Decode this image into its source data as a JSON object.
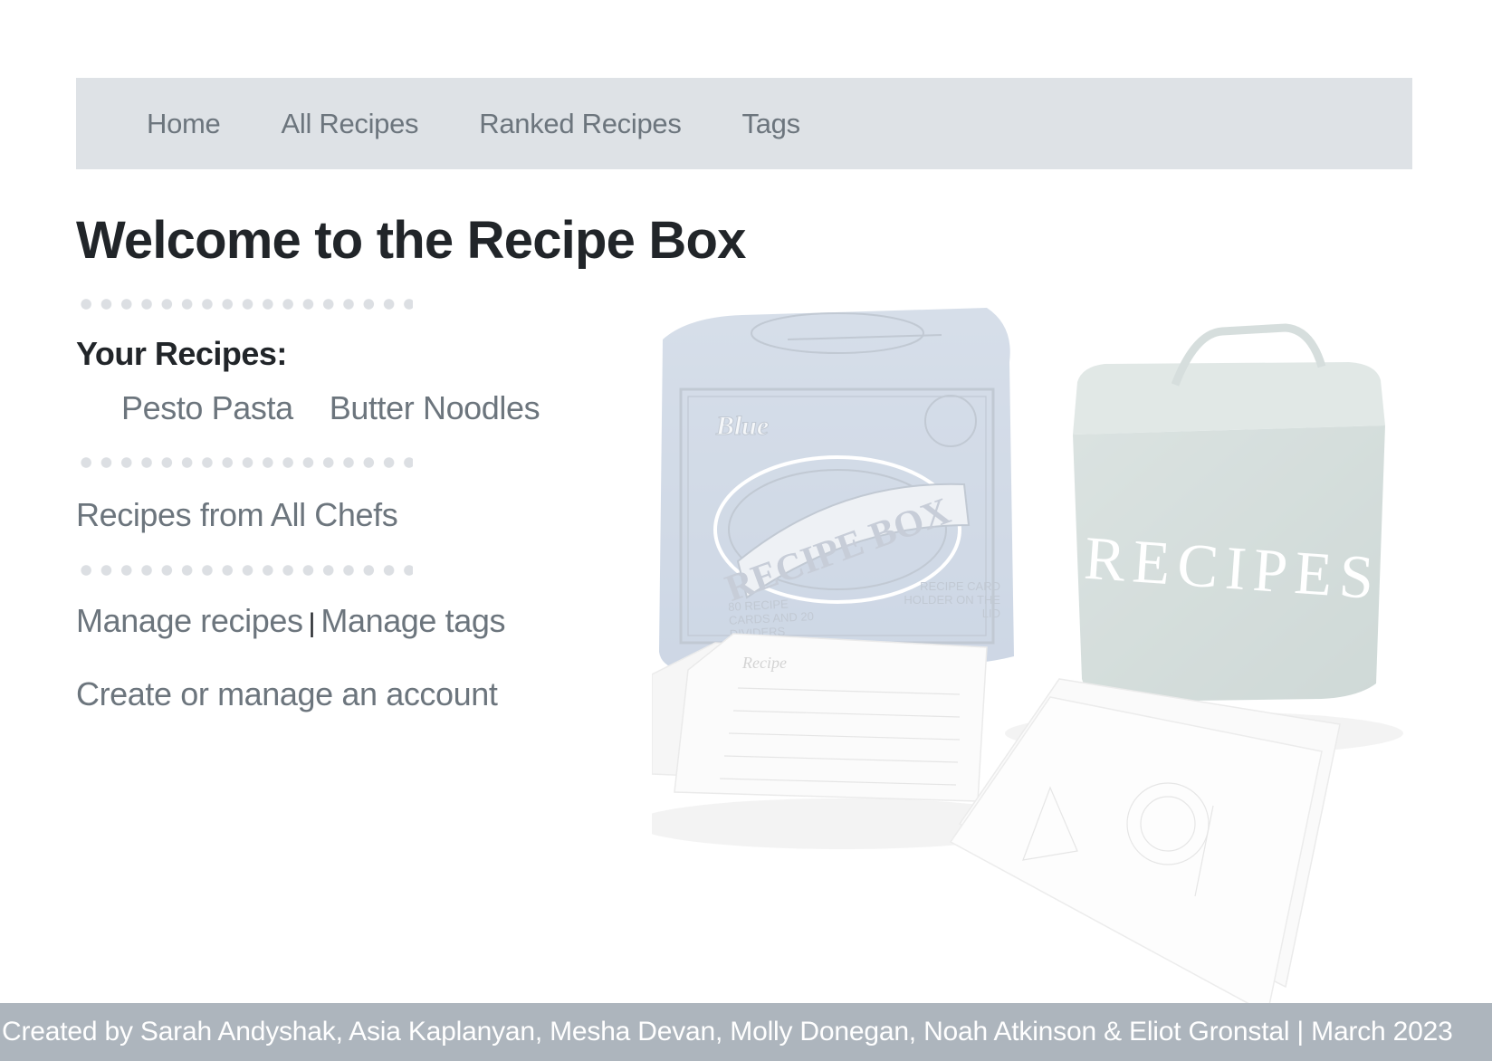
{
  "nav": {
    "items": [
      {
        "label": "Home"
      },
      {
        "label": "All Recipes"
      },
      {
        "label": "Ranked Recipes"
      },
      {
        "label": "Tags"
      }
    ]
  },
  "main": {
    "title": "Welcome to the Recipe Box",
    "your_recipes_heading": "Your Recipes:",
    "your_recipes": [
      {
        "label": "Pesto Pasta"
      },
      {
        "label": "Butter Noodles"
      }
    ],
    "all_chefs_link": "Recipes from All Chefs",
    "manage_recipes_link": "Manage recipes",
    "manage_separator": "|",
    "manage_tags_link": "Manage tags",
    "account_link": "Create or manage an account"
  },
  "hero_image": {
    "box_brand": "Blue",
    "box_title": "RECIPE BOX",
    "box_left_caption": "80 RECIPE CARDS AND 20 DIVIDERS",
    "box_right_caption": "RECIPE CARD HOLDER ON THE LID",
    "tin_label": "RECIPES",
    "card_title": "Recipe"
  },
  "footer": {
    "text": "Created by Sarah Andyshak, Asia Kaplanyan, Mesha Devan, Molly Donegan, Noah Atkinson & Eliot Gronstal | March 2023"
  },
  "colors": {
    "navbar_bg": "#dee2e6",
    "link": "#6c757d",
    "heading": "#212529",
    "footer_bg": "#adb5bd",
    "footer_text": "#ffffff"
  }
}
